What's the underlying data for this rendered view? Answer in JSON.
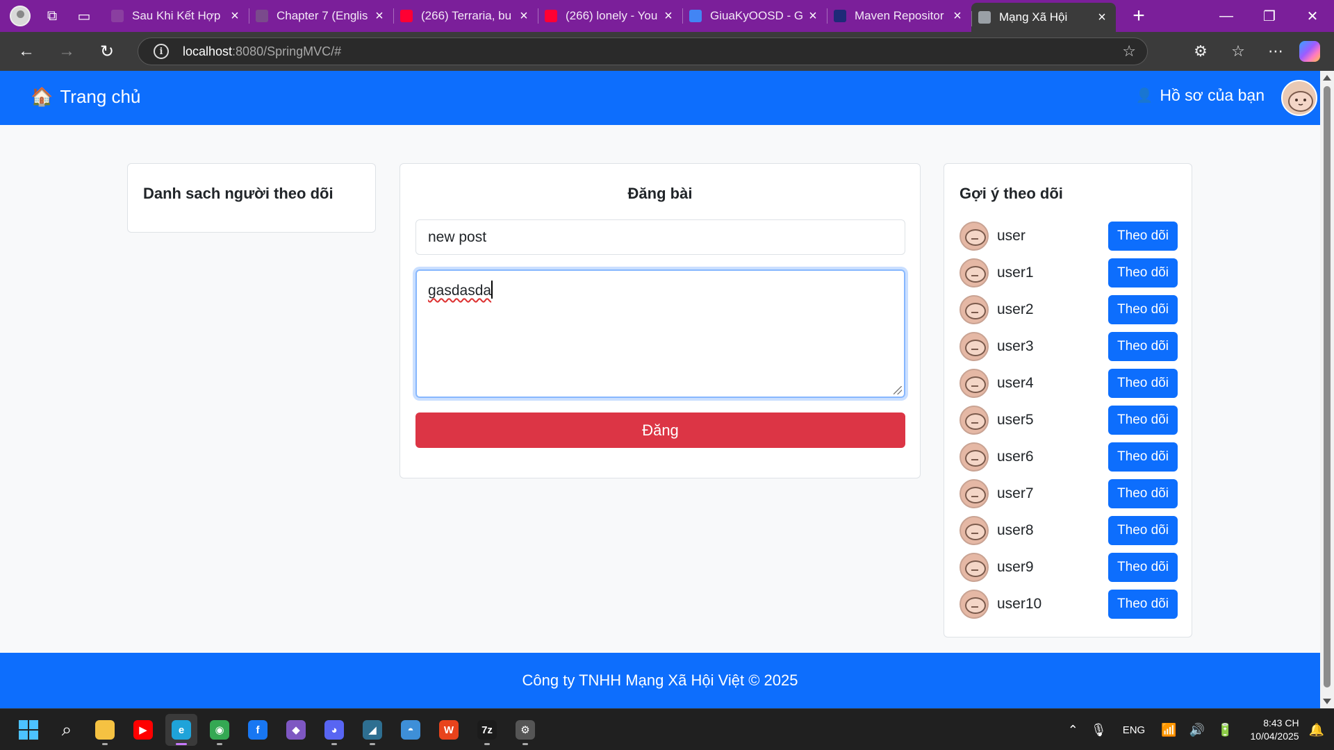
{
  "browser": {
    "tabs": [
      {
        "title": "Sau Khi Kết Hợp",
        "favicon_color": "#8a3fa0",
        "active": false
      },
      {
        "title": "Chapter 7 (Englis",
        "favicon_color": "#7a4a8c",
        "active": false
      },
      {
        "title": "(266) Terraria, bu",
        "favicon_color": "#ff0033",
        "active": false
      },
      {
        "title": "(266) lonely - You",
        "favicon_color": "#ff0033",
        "active": false
      },
      {
        "title": "GiuaKyOOSD - G",
        "favicon_color": "#4285f4",
        "active": false
      },
      {
        "title": "Maven Repositor",
        "favicon_color": "#1e2a78",
        "active": false
      },
      {
        "title": "Mạng Xã Hội",
        "favicon_color": "#9aa0a6",
        "active": true
      }
    ],
    "url_host": "localhost",
    "url_rest": ":8080/SpringMVC/#"
  },
  "header": {
    "brand_icon": "🏠",
    "brand_label": "Trang chủ",
    "profile_icon": "👤",
    "profile_label": "Hồ sơ của bạn"
  },
  "followers": {
    "title": "Danh sach người theo dõi"
  },
  "post_form": {
    "title": "Đăng bài",
    "title_value": "new post",
    "content_value": "gasdasda",
    "submit_label": "Đăng"
  },
  "suggestions": {
    "title": "Gợi ý theo dõi",
    "follow_label": "Theo dõi",
    "users": [
      "user",
      "user1",
      "user2",
      "user3",
      "user4",
      "user5",
      "user6",
      "user7",
      "user8",
      "user9",
      "user10"
    ]
  },
  "footer": {
    "text": "Công ty TNHH Mạng Xã Hội Việt © 2025"
  },
  "taskbar": {
    "apps": [
      {
        "name": "start-icon",
        "color": "#4cc2ff",
        "glyph": ""
      },
      {
        "name": "search-icon",
        "color": "transparent",
        "glyph": "⌕"
      },
      {
        "name": "file-explorer-icon",
        "color": "#f5c242",
        "glyph": ""
      },
      {
        "name": "youtube-icon",
        "color": "#ff0000",
        "glyph": "▶"
      },
      {
        "name": "edge-icon",
        "color": "#1fa3d9",
        "glyph": "e"
      },
      {
        "name": "chrome-icon",
        "color": "#34a853",
        "glyph": "◉"
      },
      {
        "name": "facebook-icon",
        "color": "#1877f2",
        "glyph": "f"
      },
      {
        "name": "visual-studio-icon",
        "color": "#7e57c2",
        "glyph": "◆"
      },
      {
        "name": "discord-icon",
        "color": "#5865f2",
        "glyph": "◕"
      },
      {
        "name": "mysql-workbench-icon",
        "color": "#2e6f91",
        "glyph": "◢"
      },
      {
        "name": "preview-icon",
        "color": "#3e8fd8",
        "glyph": "◓"
      },
      {
        "name": "wps-office-icon",
        "color": "#e8431c",
        "glyph": "W"
      },
      {
        "name": "7zip-icon",
        "color": "#1b1b1b",
        "glyph": "7z"
      },
      {
        "name": "settings-icon",
        "color": "#555555",
        "glyph": "⚙"
      }
    ],
    "language": "ENG",
    "time": "8:43 CH",
    "date": "10/04/2025"
  }
}
